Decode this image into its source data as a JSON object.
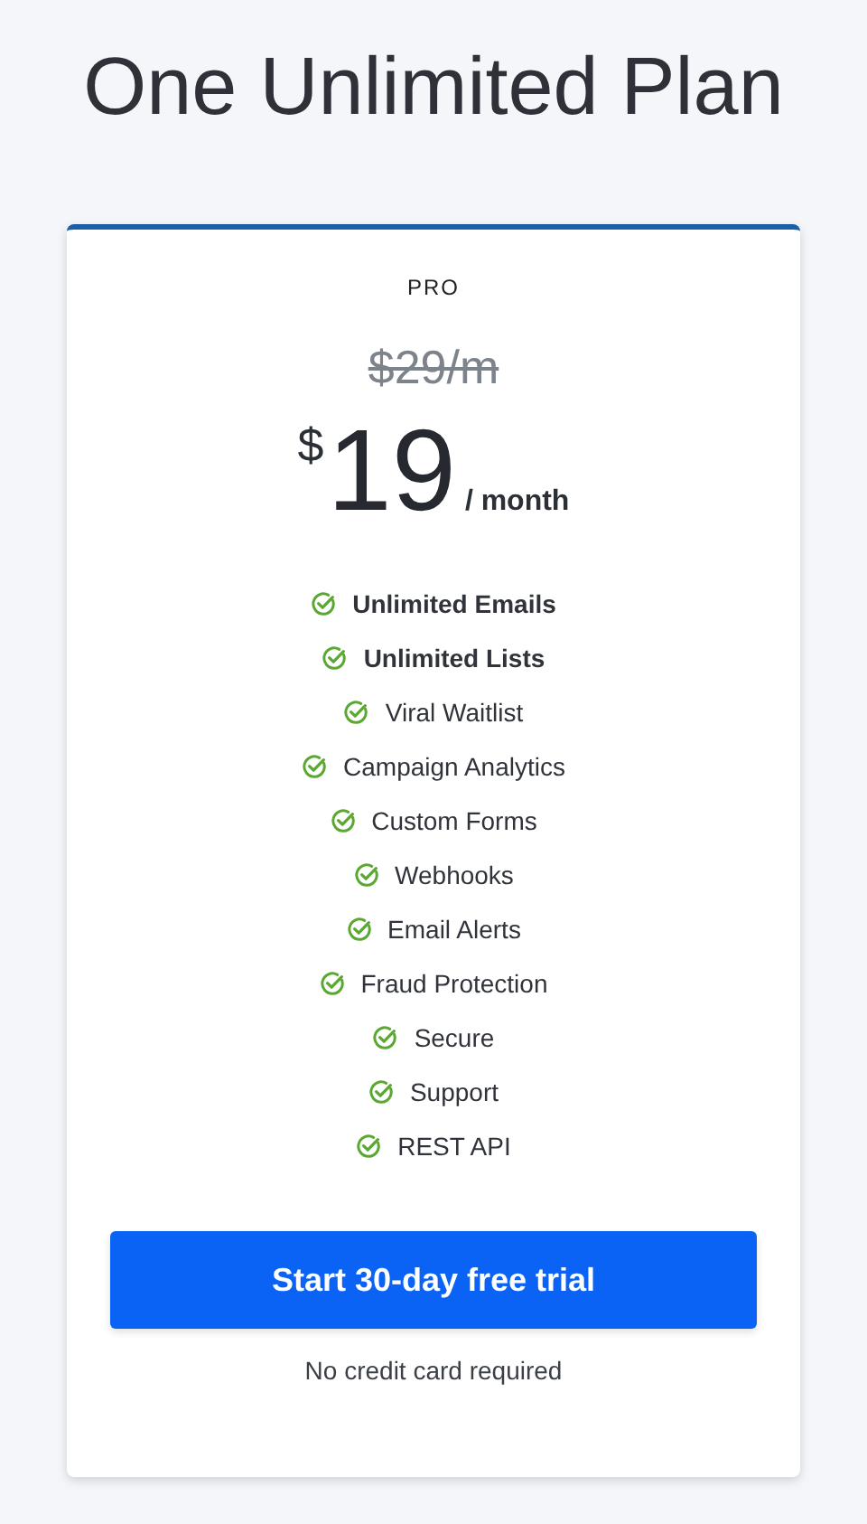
{
  "heading": "One Unlimited Plan",
  "plan": {
    "name": "PRO",
    "old_price": "$29/m",
    "currency": "$",
    "price": "19",
    "period": "/ month",
    "features": [
      {
        "label": "Unlimited Emails",
        "emphasized": true
      },
      {
        "label": "Unlimited Lists",
        "emphasized": true
      },
      {
        "label": "Viral Waitlist",
        "emphasized": false
      },
      {
        "label": "Campaign Analytics",
        "emphasized": false
      },
      {
        "label": "Custom Forms",
        "emphasized": false
      },
      {
        "label": "Webhooks",
        "emphasized": false
      },
      {
        "label": "Email Alerts",
        "emphasized": false
      },
      {
        "label": "Fraud Protection",
        "emphasized": false
      },
      {
        "label": "Secure",
        "emphasized": false
      },
      {
        "label": "Support",
        "emphasized": false
      },
      {
        "label": "REST API",
        "emphasized": false
      }
    ],
    "cta": "Start 30-day free trial",
    "note": "No credit card required"
  }
}
